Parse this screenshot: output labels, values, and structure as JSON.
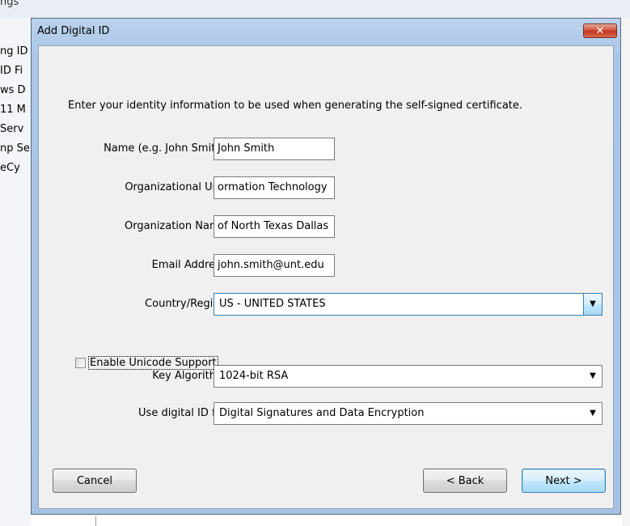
{
  "background": {
    "top_text": "ngs",
    "left_items": [
      "ng ID",
      "ID Fi",
      "ws D",
      "11 M",
      "Serv",
      "np Se",
      "eCy"
    ]
  },
  "dialog": {
    "title": "Add Digital ID",
    "close_glyph": "✕",
    "instructions": "Enter your identity information to be used when generating the self-signed certificate.",
    "fields": {
      "name": {
        "label": "Name (e.g. John Smith):",
        "value": "John Smith"
      },
      "org_unit": {
        "label": "Organizational Unit:",
        "value": "ormation Technology"
      },
      "org_name": {
        "label": "Organization Name:",
        "value": "of North Texas Dallas"
      },
      "email": {
        "label": "Email Address:",
        "value": "john.smith@unt.edu"
      },
      "country": {
        "label": "Country/Region:",
        "value": "US - UNITED STATES"
      },
      "unicode": {
        "label": "Enable Unicode Support",
        "checked": false
      },
      "key_algorithm": {
        "label": "Key Algorithm:",
        "value": "1024-bit RSA"
      },
      "use_for": {
        "label": "Use digital ID for:",
        "value": "Digital Signatures and Data Encryption"
      }
    },
    "buttons": {
      "cancel": "Cancel",
      "back": "< Back",
      "next": "Next >"
    }
  },
  "icons": {
    "close": "close-icon",
    "dropdown": "chevron-down-icon"
  },
  "colors": {
    "window_frame": "#a9c6e8",
    "client_bg": "#f0f0f0",
    "close_button": "#c2351f",
    "focus_blue": "#3c7fb1"
  }
}
